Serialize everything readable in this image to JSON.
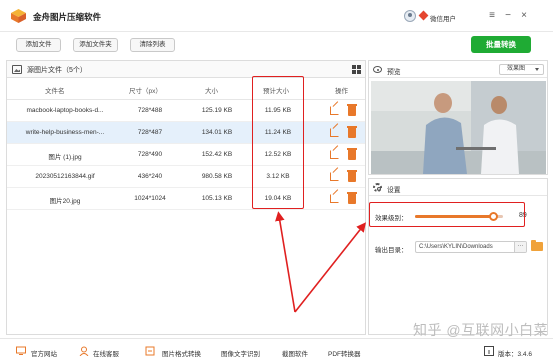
{
  "app": {
    "title": "金舟图片压缩软件",
    "user_name": "微信用户"
  },
  "toolbar": {
    "add_file": "添加文件",
    "add_folder": "添加文件夹",
    "clear_list": "清除列表",
    "batch_convert": "批量转换"
  },
  "list": {
    "title": "源图片文件（5个）",
    "columns": [
      "文件名",
      "尺寸（px）",
      "大小",
      "预计大小",
      "操作"
    ],
    "rows": [
      {
        "name": "macbook-laptop-books-d...",
        "dimension": "728*488",
        "size": "125.19 KB",
        "estimated": "11.95 KB"
      },
      {
        "name": "write-help-business-men-...",
        "dimension": "728*487",
        "size": "134.01 KB",
        "estimated": "11.24 KB"
      },
      {
        "name": "图片 (1).jpg",
        "dimension": "728*490",
        "size": "152.42 KB",
        "estimated": "12.52 KB"
      },
      {
        "name": "20230512163844.gif",
        "dimension": "436*240",
        "size": "980.58 KB",
        "estimated": "3.12 KB"
      },
      {
        "name": "图片20.jpg",
        "dimension": "1024*1024",
        "size": "105.13 KB",
        "estimated": "19.04 KB"
      }
    ],
    "selected_row": 1
  },
  "preview": {
    "title": "预览",
    "mode": "效果图"
  },
  "settings": {
    "title": "设置",
    "effect_label": "效果级别：",
    "effect_value": 89,
    "effect_value_text": "89",
    "output_label": "输出目录：",
    "output_path": "C:\\Users\\KYLIN\\Downloads",
    "more": "···"
  },
  "footer": {
    "items": [
      "官方网站",
      "在线客服",
      "图片格式转换",
      "图像文字识别",
      "截图软件",
      "PDF转换器"
    ],
    "version": "版本：3.4.6"
  },
  "watermark": "知乎 @互联网小白菜",
  "colors": {
    "accent": "#e8782a",
    "batch_green": "#1fab34",
    "highlight_red": "#e02020",
    "selected_row": "#e5f0fb"
  }
}
